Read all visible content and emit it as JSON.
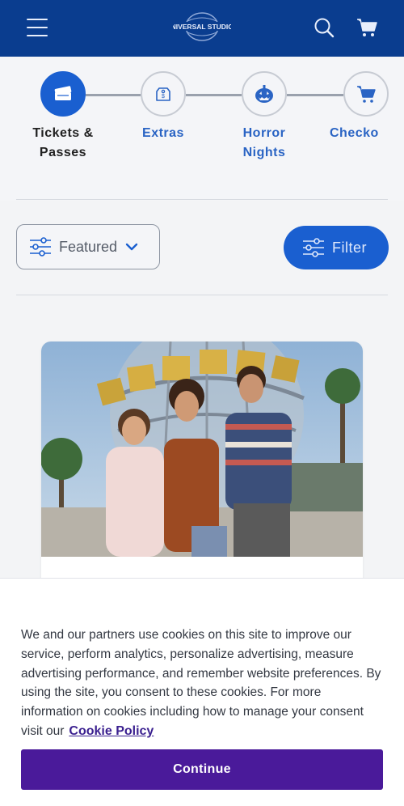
{
  "header": {
    "menu_icon": "hamburger-icon",
    "logo_text": "UNIVERSAL STUDIOS",
    "search_icon": "search-icon",
    "cart_icon": "cart-icon",
    "background": "#0a3d8f"
  },
  "stepper": {
    "steps": [
      {
        "label_line1": "Tickets &",
        "label_line2": "Passes",
        "icon": "ticket-icon",
        "active": true
      },
      {
        "label_line1": "Extras",
        "label_line2": "",
        "icon": "tag-icon",
        "active": false
      },
      {
        "label_line1": "Horror",
        "label_line2": "Nights",
        "icon": "pumpkin-icon",
        "active": false
      },
      {
        "label_line1": "Checko",
        "label_line2": "",
        "icon": "cart-icon",
        "active": false
      }
    ]
  },
  "toolbar": {
    "sort_label": "Featured",
    "filter_label": "Filter"
  },
  "card": {
    "image_alt": "Family at Universal Studios globe"
  },
  "cookie": {
    "text": "We and our partners use cookies on this site to improve our service, perform analytics, personalize advertising, measure advertising performance, and remember website preferences. By using the site, you consent to these cookies. For more information on cookies including how to manage your consent visit our",
    "link_label": "Cookie Policy",
    "continue_label": "Continue"
  },
  "colors": {
    "brand_blue": "#1a5fd0",
    "header_blue": "#0a3d8f",
    "cookie_purple": "#4a1a9a"
  }
}
